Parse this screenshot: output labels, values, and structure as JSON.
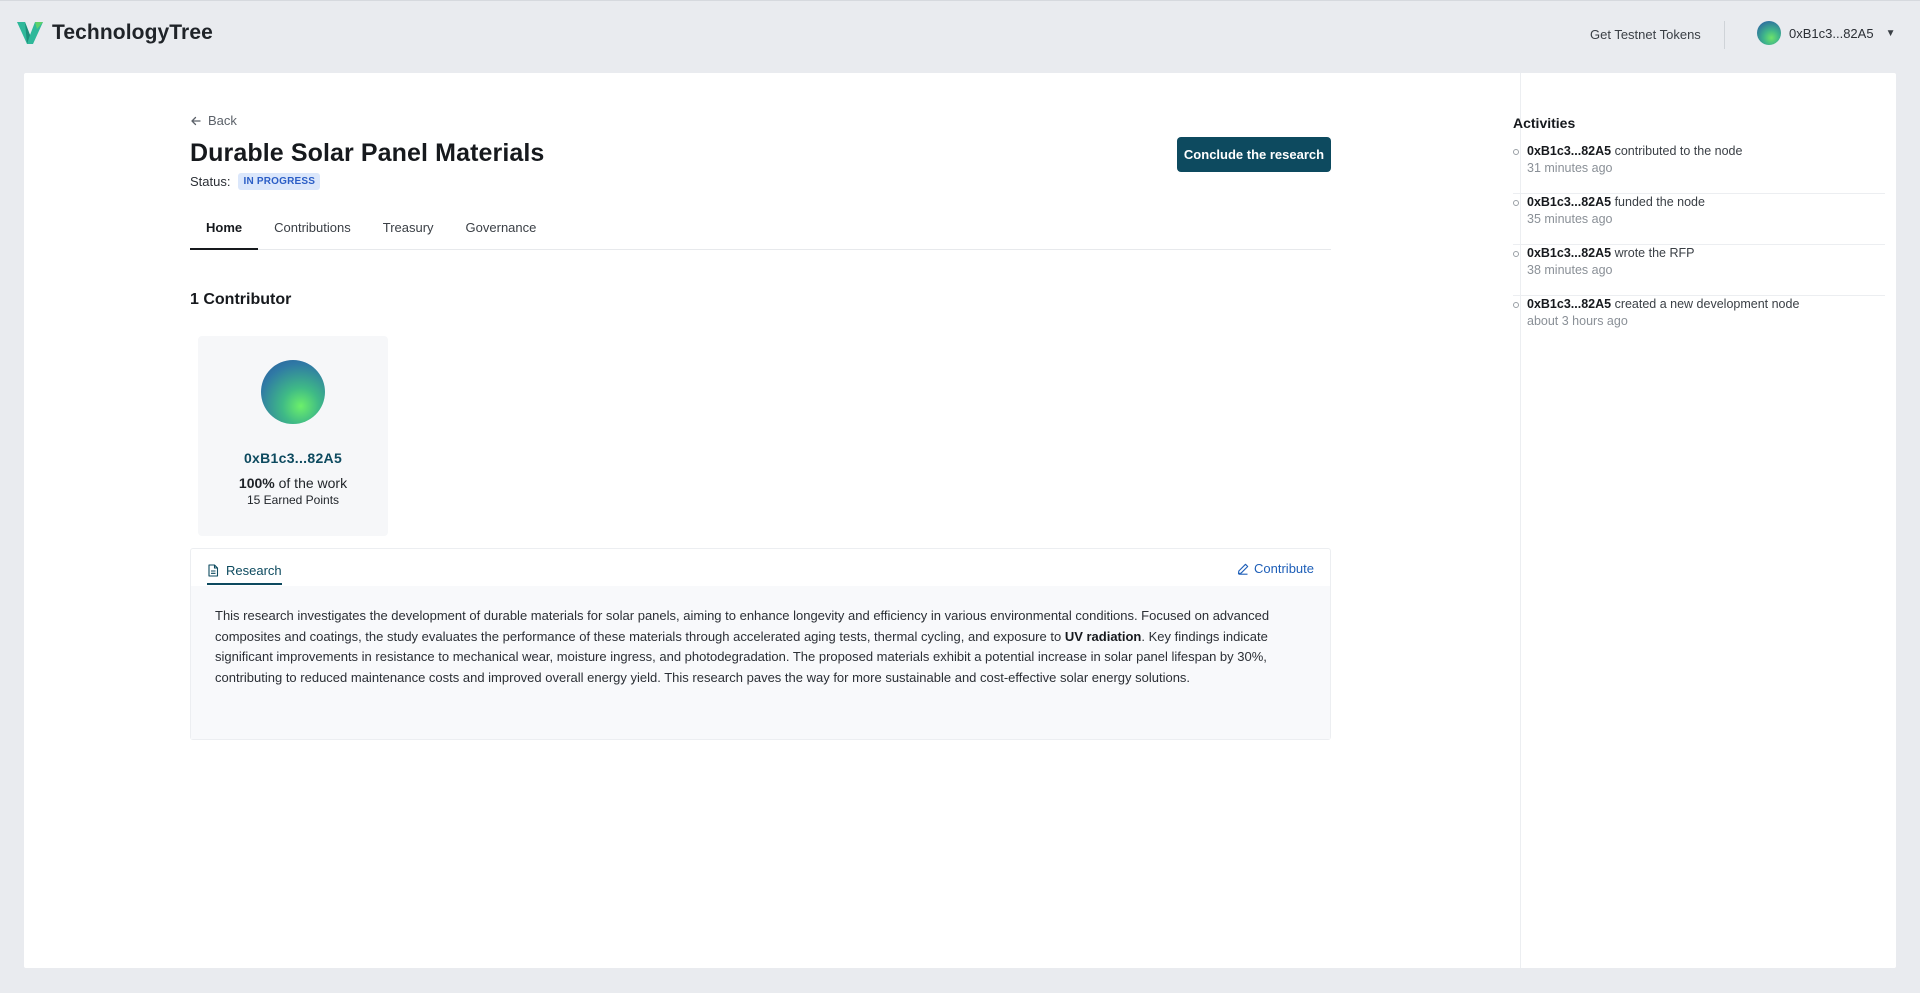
{
  "app": {
    "name": "TechnologyTree",
    "testnet_link": "Get Testnet Tokens",
    "account_address": "0xB1c3...82A5"
  },
  "page": {
    "back_label": "Back",
    "title": "Durable Solar Panel Materials",
    "status_label": "Status:",
    "status_value": "IN PROGRESS",
    "conclude_button": "Conclude the research",
    "tabs": [
      {
        "label": "Home",
        "active": true
      },
      {
        "label": "Contributions",
        "active": false
      },
      {
        "label": "Treasury",
        "active": false
      },
      {
        "label": "Governance",
        "active": false
      }
    ]
  },
  "contributors": {
    "heading": "1 Contributor",
    "items": [
      {
        "address": "0xB1c3...82A5",
        "share_value": "100%",
        "share_suffix": " of the work",
        "points": "15 Earned Points"
      }
    ]
  },
  "research": {
    "tab_label": "Research",
    "contribute_label": "Contribute",
    "body_part1": "This research investigates the development of durable materials for solar panels, aiming to enhance longevity and efficiency in various environmental conditions. Focused on advanced composites and coatings, the study evaluates the performance of these materials through accelerated aging tests, thermal cycling, and exposure to ",
    "body_bold": "UV radiation",
    "body_part2": ". Key findings indicate significant improvements in resistance to mechanical wear, moisture ingress, and photodegradation. The proposed materials exhibit a potential increase in solar panel lifespan by 30%, contributing to reduced maintenance costs and improved overall energy yield. This research paves the way for more sustainable and cost-effective solar energy solutions."
  },
  "activities": {
    "title": "Activities",
    "items": [
      {
        "address": "0xB1c3...82A5",
        "action": " contributed to the node",
        "time": "31 minutes ago"
      },
      {
        "address": "0xB1c3...82A5",
        "action": " funded the node",
        "time": "35 minutes ago"
      },
      {
        "address": "0xB1c3...82A5",
        "action": " wrote the RFP",
        "time": "38 minutes ago"
      },
      {
        "address": "0xB1c3...82A5",
        "action": " created a new development node",
        "time": "about 3 hours ago"
      }
    ]
  },
  "colors": {
    "primary": "#0d4a5f",
    "link": "#1e5fb8",
    "status_badge_bg": "#dbe7fb",
    "status_badge_text": "#2b5ec6",
    "background": "#e9ebef"
  }
}
